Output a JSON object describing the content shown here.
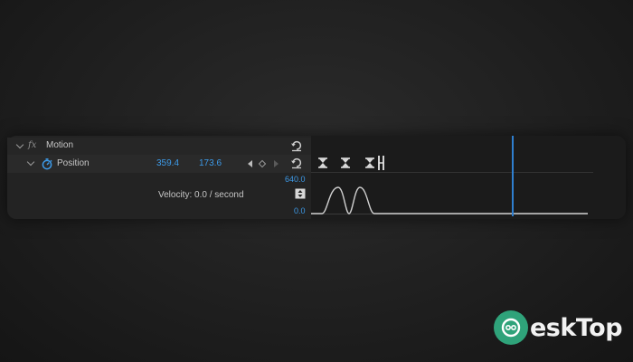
{
  "effect": {
    "fx_label": "fx",
    "name": "Motion"
  },
  "position": {
    "label": "Position",
    "x_value": "359.4",
    "y_value": "173.6"
  },
  "velocity": {
    "text": "Velocity: 0.0 / second",
    "max_value": "640.0",
    "min_value": "0.0"
  },
  "colors": {
    "value_blue": "#3d9ae8",
    "playhead": "#2f7fcf",
    "watermark_green": "#2fa37a"
  },
  "icons": {
    "reset": "reset-icon",
    "stopwatch": "stopwatch-icon",
    "prev_keyframe": "prev-keyframe-icon",
    "add_keyframe": "add-keyframe-icon",
    "next_keyframe": "next-keyframe-icon",
    "graph_toggle": "graph-toggle-icon",
    "hourglass_keyframe": "hourglass-keyframe-icon"
  },
  "watermark": {
    "text": "eskTop"
  }
}
